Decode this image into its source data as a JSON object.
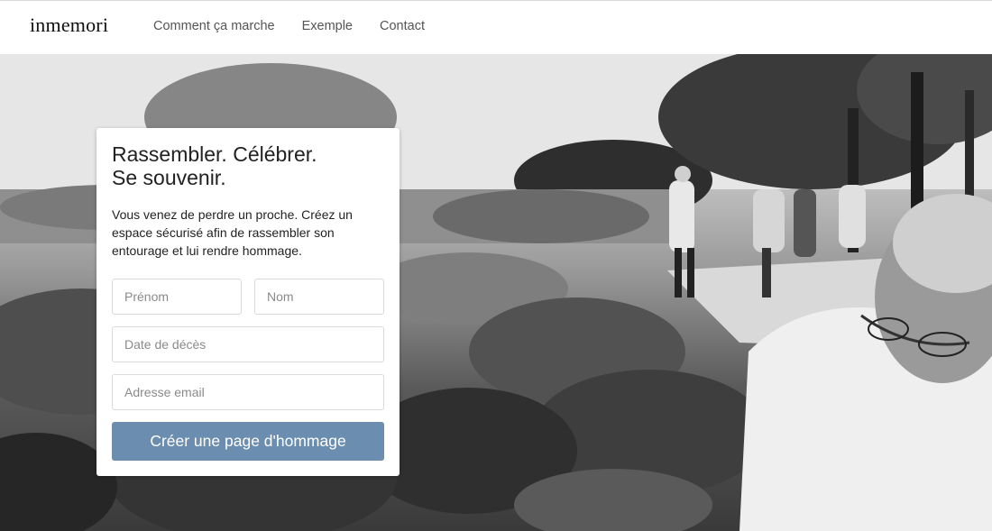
{
  "header": {
    "logo": "inmemori",
    "nav": [
      {
        "label": "Comment ça marche"
      },
      {
        "label": "Exemple"
      },
      {
        "label": "Contact"
      }
    ]
  },
  "card": {
    "title_line1": "Rassembler. Célébrer.",
    "title_line2": "Se souvenir.",
    "description": "Vous venez de perdre un proche. Créez un espace sécurisé afin de rassembler son entourage et lui rendre hommage.",
    "fields": {
      "first_name": {
        "placeholder": "Prénom",
        "value": ""
      },
      "last_name": {
        "placeholder": "Nom",
        "value": ""
      },
      "death_date": {
        "placeholder": "Date de décès",
        "value": ""
      },
      "email": {
        "placeholder": "Adresse email",
        "value": ""
      }
    },
    "submit_label": "Créer une page d'hommage"
  },
  "colors": {
    "accent": "#6a8db0",
    "nav_text": "#555555"
  }
}
